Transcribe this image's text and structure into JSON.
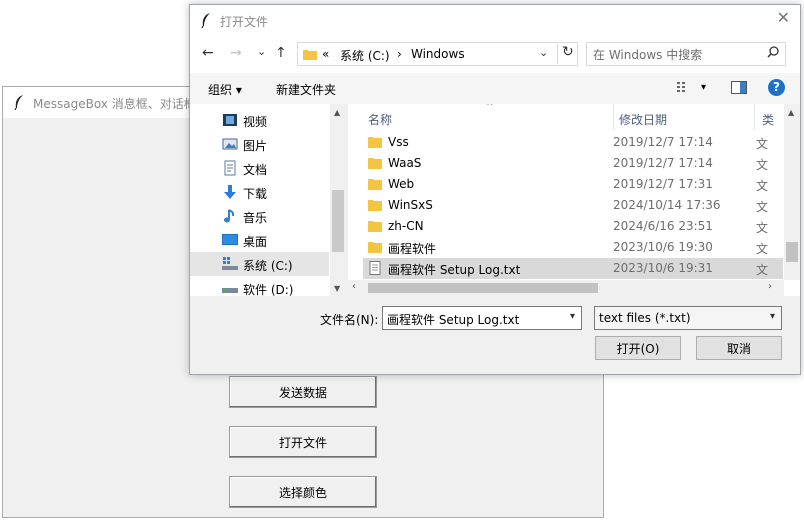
{
  "background_window": {
    "title": "MessageBox 消息框、对话框",
    "buttons": [
      "发送数据",
      "打开文件",
      "选择颜色"
    ]
  },
  "dialog": {
    "title": "打开文件",
    "close_symbol": "✕",
    "nav": {
      "back": "←",
      "forward": "→",
      "recent": "⌄",
      "up": "↑",
      "breadcrumb_overflow": "«",
      "breadcrumb": [
        "系统 (C:)",
        "Windows"
      ],
      "separator": "›",
      "address_dropdown": "⌄",
      "refresh": "↻",
      "search_placeholder": "在 Windows 中搜索"
    },
    "toolbar": {
      "organize": "组织 ▾",
      "new_folder": "新建文件夹",
      "view_menu": "▾",
      "help": "?"
    },
    "nav_pane": [
      {
        "label": "视频",
        "icon": "video-icon"
      },
      {
        "label": "图片",
        "icon": "pictures-icon"
      },
      {
        "label": "文档",
        "icon": "documents-icon"
      },
      {
        "label": "下载",
        "icon": "download-icon"
      },
      {
        "label": "音乐",
        "icon": "music-icon"
      },
      {
        "label": "桌面",
        "icon": "desktop-icon"
      },
      {
        "label": "系统 (C:)",
        "icon": "drive-c-icon",
        "selected": true
      },
      {
        "label": "软件 (D:)",
        "icon": "drive-d-icon"
      }
    ],
    "columns": {
      "name": "名称",
      "date": "修改日期",
      "type": "类"
    },
    "files": [
      {
        "name": "Vss",
        "date": "2019/12/7 17:14",
        "type": "文",
        "kind": "folder"
      },
      {
        "name": "WaaS",
        "date": "2019/12/7 17:14",
        "type": "文",
        "kind": "folder"
      },
      {
        "name": "Web",
        "date": "2019/12/7 17:31",
        "type": "文",
        "kind": "folder"
      },
      {
        "name": "WinSxS",
        "date": "2024/10/14 17:36",
        "type": "文",
        "kind": "folder"
      },
      {
        "name": "zh-CN",
        "date": "2024/6/16 23:51",
        "type": "文",
        "kind": "folder"
      },
      {
        "name": "画程软件",
        "date": "2023/10/6 19:30",
        "type": "文",
        "kind": "folder"
      },
      {
        "name": "画程软件 Setup Log.txt",
        "date": "2023/10/6 19:31",
        "type": "文",
        "kind": "text",
        "selected": true
      }
    ],
    "bottom": {
      "filename_label": "文件名(N):",
      "filename_value": "画程软件 Setup Log.txt",
      "filetype_value": "text files (*.txt)",
      "open_button": "打开(O)",
      "cancel_button": "取消"
    }
  },
  "colors": {
    "folder": "#f4c542",
    "selection": "#d9d9d9",
    "help_blue": "#1a73c8",
    "header_text": "#4c607a"
  }
}
